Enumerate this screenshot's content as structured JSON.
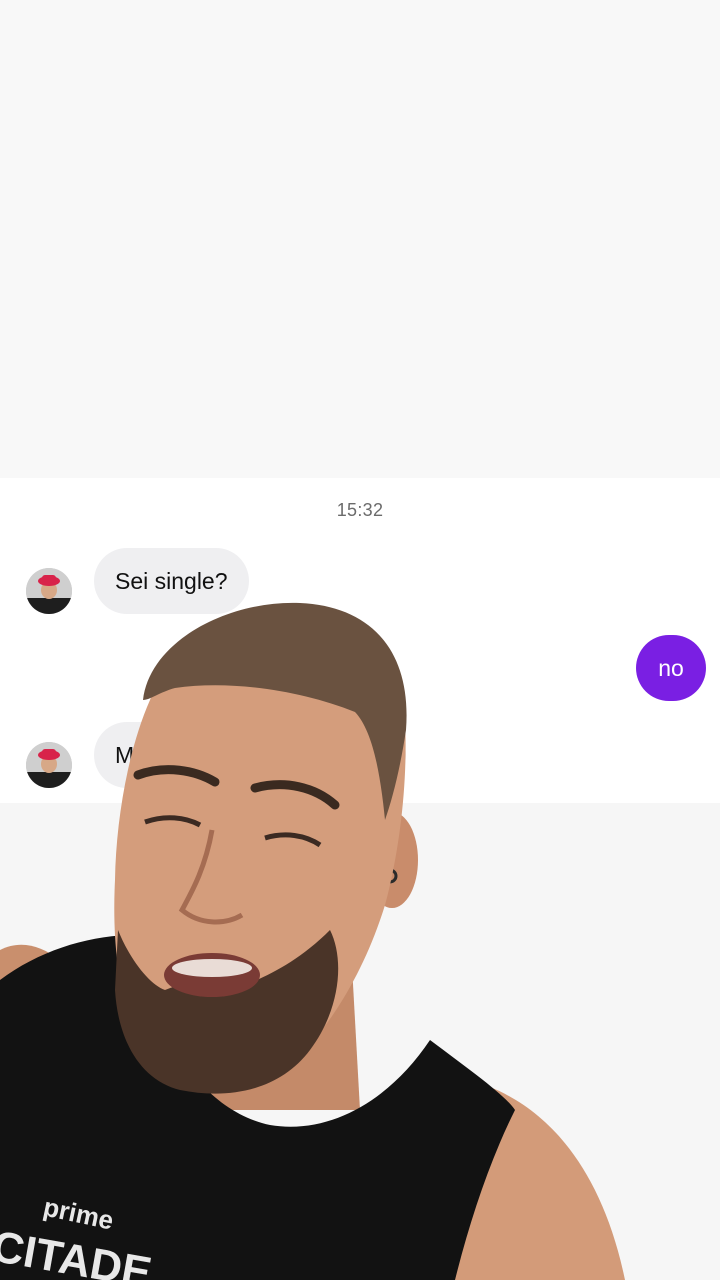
{
  "chat": {
    "timestamp": "15:32",
    "messages": [
      {
        "sender": "other",
        "text": "Sei single?"
      },
      {
        "sender": "me",
        "text": "no"
      },
      {
        "sender": "other",
        "text": "M"
      }
    ]
  },
  "overlay": {
    "shirt_text_1": "prime",
    "shirt_text_2": "CITADE"
  },
  "colors": {
    "outgoing_bubble": "#7a1fe3",
    "incoming_bubble": "#efeff1",
    "avatar_hat": "#d8234a"
  },
  "icons": {
    "avatar": "avatar-icon"
  }
}
